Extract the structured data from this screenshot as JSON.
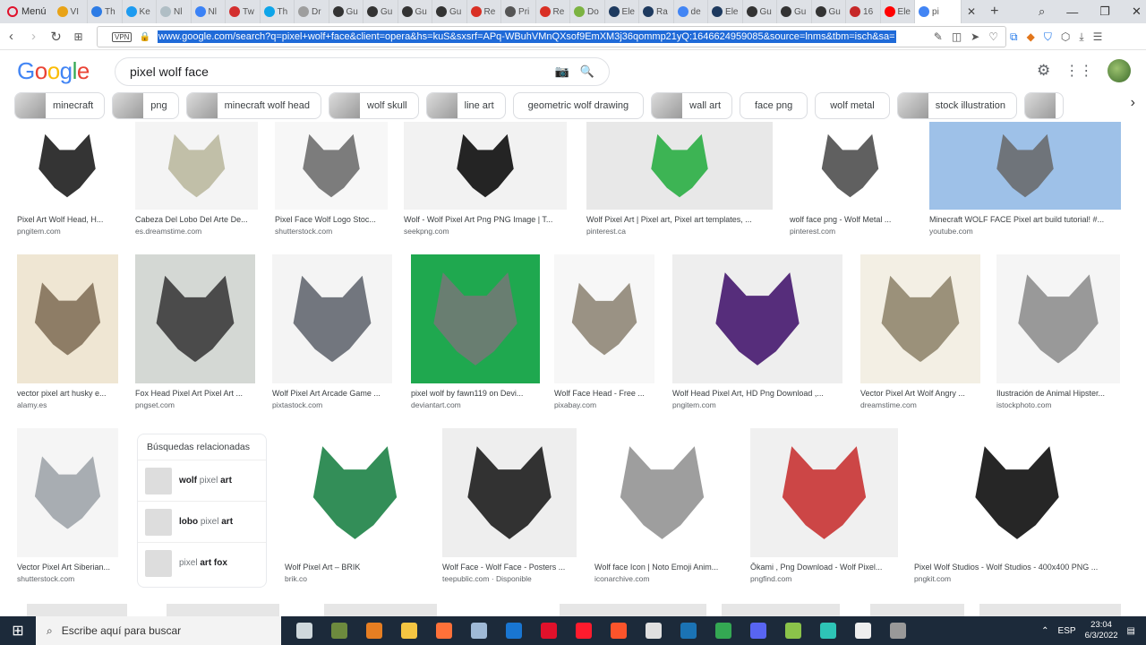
{
  "browser": {
    "menu_label": "Menú",
    "tabs": [
      {
        "label": "VI",
        "color": "#e8a317"
      },
      {
        "label": "Th",
        "color": "#2c7be5"
      },
      {
        "label": "Ke",
        "color": "#1d9bf0"
      },
      {
        "label": "Nl",
        "color": "#b0bec5"
      },
      {
        "label": "Nl",
        "color": "#3b82f6"
      },
      {
        "label": "Tw",
        "color": "#d32f2f"
      },
      {
        "label": "Th",
        "color": "#0ea5e9"
      },
      {
        "label": "Dr",
        "color": "#9e9e9e"
      },
      {
        "label": "Gu",
        "color": "#333333"
      },
      {
        "label": "Gu",
        "color": "#333333"
      },
      {
        "label": "Gu",
        "color": "#333333"
      },
      {
        "label": "Gu",
        "color": "#333333"
      },
      {
        "label": "Re",
        "color": "#d93025"
      },
      {
        "label": "Pri",
        "color": "#555555"
      },
      {
        "label": "Re",
        "color": "#d93025"
      },
      {
        "label": "Do",
        "color": "#7cb342"
      },
      {
        "label": "Ele",
        "color": "#1e3a5f"
      },
      {
        "label": "Ra",
        "color": "#1e3a5f"
      },
      {
        "label": "de",
        "color": "#4285f4"
      },
      {
        "label": "Ele",
        "color": "#1e3a5f"
      },
      {
        "label": "Gu",
        "color": "#333333"
      },
      {
        "label": "Gu",
        "color": "#333333"
      },
      {
        "label": "Gu",
        "color": "#333333"
      },
      {
        "label": "16",
        "color": "#c62828"
      },
      {
        "label": "Ele",
        "color": "#ff0000"
      }
    ],
    "active_tab": "pi",
    "url": "www.google.com/search?q=pixel+wolf+face&client=opera&hs=kuS&sxsrf=APq-WBuhVMnQXsof9EmXM3j36qommp21yQ:1646624959085&source=lnms&tbm=isch&sa=",
    "vpn_label": "VPN"
  },
  "google": {
    "logo": "Google",
    "query": "pixel wolf face"
  },
  "chips": [
    {
      "label": "minecraft",
      "thumb": true
    },
    {
      "label": "png",
      "thumb": true
    },
    {
      "label": "minecraft wolf head",
      "thumb": true
    },
    {
      "label": "wolf skull",
      "thumb": true
    },
    {
      "label": "line art",
      "thumb": true
    },
    {
      "label": "geometric wolf drawing",
      "thumb": false
    },
    {
      "label": "wall art",
      "thumb": true
    },
    {
      "label": "face png",
      "thumb": false
    },
    {
      "label": "wolf metal",
      "thumb": false
    },
    {
      "label": "stock illustration",
      "thumb": true
    },
    {
      "label": "",
      "thumb": true
    }
  ],
  "results": {
    "row1": [
      {
        "caption": "Pixel Art Wolf Head, H...",
        "source": "pngitem.com",
        "bg": "#ffffff",
        "fg": "#111111"
      },
      {
        "caption": "Cabeza Del Lobo Del Arte De...",
        "source": "es.dreamstime.com",
        "bg": "#f4f4f4",
        "fg": "#b7b59a"
      },
      {
        "caption": "Pixel Face Wolf Logo Stoc...",
        "source": "shutterstock.com",
        "bg": "#f7f7f7",
        "fg": "#666666"
      },
      {
        "caption": "Wolf - Wolf Pixel Art Png PNG Image | T...",
        "source": "seekpng.com",
        "bg": "#f2f2f2",
        "fg": "#000000"
      },
      {
        "caption": "Wolf Pixel Art | Pixel art, Pixel art templates, ...",
        "source": "pinterest.ca",
        "bg": "#e8e8e8",
        "fg": "#1faa3a"
      },
      {
        "caption": "wolf face png - Wolf Metal ...",
        "source": "pinterest.com",
        "bg": "#ffffff",
        "fg": "#444444"
      },
      {
        "caption": "Minecraft WOLF FACE Pixel art build tutorial! #...",
        "source": "youtube.com",
        "bg": "#9ec1e8",
        "fg": "#666666"
      }
    ],
    "row2": [
      {
        "caption": "vector pixel art husky e...",
        "source": "alamy.es",
        "bg": "#efe6d3",
        "fg": "#7d6a52"
      },
      {
        "caption": "Fox Head Pixel Art Pixel Art ...",
        "source": "pngset.com",
        "bg": "#d4d8d4",
        "fg": "#333333"
      },
      {
        "caption": "Wolf Pixel Art Arcade Game ...",
        "source": "pixtastock.com",
        "bg": "#f4f4f4",
        "fg": "#5a5f68"
      },
      {
        "caption": "pixel wolf by fawn119 on Devi...",
        "source": "deviantart.com",
        "bg": "#1fa84f",
        "fg": "#777777"
      },
      {
        "caption": "Wolf Face Head - Free ...",
        "source": "pixabay.com",
        "bg": "#f7f7f7",
        "fg": "#8a8070"
      },
      {
        "caption": "Wolf Head Pixel Art, HD Png Download ,...",
        "source": "pngitem.com",
        "bg": "#eeeeee",
        "fg": "#3b0a66"
      },
      {
        "caption": "Vector Pixel Art Wolf Angry ...",
        "source": "dreamstime.com",
        "bg": "#f3efe4",
        "fg": "#8b8067"
      },
      {
        "caption": "Ilustración de Animal Hipster...",
        "source": "istockphoto.com",
        "bg": "#f5f5f5",
        "fg": "#888888"
      }
    ],
    "row3": [
      {
        "caption": "Vector Pixel Art Siberian...",
        "source": "shutterstock.com",
        "bg": "#f5f5f5",
        "fg": "#9aa0a6"
      },
      {
        "caption": "Wolf Pixel Art – BRIK",
        "source": "brik.co",
        "bg": "#ffffff",
        "fg": "#0f7a3b"
      },
      {
        "caption": "Wolf Face - Wolf Face - Posters ...",
        "source": "teepublic.com",
        "source_extra": "Disponible",
        "bg": "#eeeeee",
        "fg": "#111111"
      },
      {
        "caption": "Wolf face Icon | Noto Emoji Anim...",
        "source": "iconarchive.com",
        "bg": "#ffffff",
        "fg": "#8d8d8d"
      },
      {
        "caption": "Ōkami , Png Download - Wolf Pixel...",
        "source": "pngfind.com",
        "bg": "#f0f0f0",
        "fg": "#c62828"
      },
      {
        "caption": "Pixel Wolf Studios - Wolf Studios - 400x400 PNG ...",
        "source": "pngkit.com",
        "bg": "#ffffff",
        "fg": "#000000"
      }
    ]
  },
  "related": {
    "title": "Búsquedas relacionadas",
    "items": [
      {
        "bold": "wolf",
        "light": " pixel ",
        "bold2": "art"
      },
      {
        "bold": "lobo",
        "light": " pixel ",
        "bold2": "art"
      },
      {
        "bold": "",
        "light": "pixel ",
        "bold2": "art fox"
      }
    ]
  },
  "taskbar": {
    "search_placeholder": "Escribe aquí para buscar",
    "lang": "ESP",
    "time": "23:04",
    "date": "6/3/2022"
  }
}
